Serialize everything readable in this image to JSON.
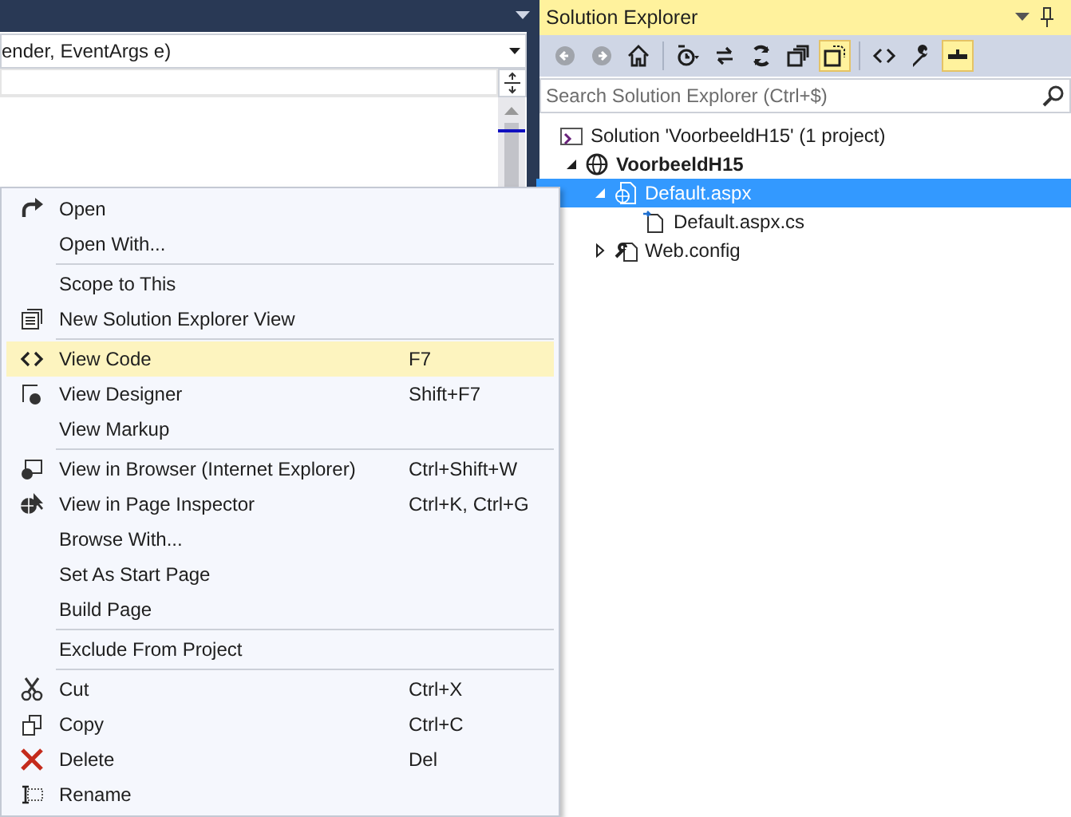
{
  "editor": {
    "member_dropdown": {
      "value": "ender, EventArgs e)"
    }
  },
  "solution_explorer": {
    "title": "Solution Explorer",
    "toolbar": [
      {
        "kind": "back",
        "disabled": true,
        "on": false
      },
      {
        "kind": "forward",
        "disabled": true,
        "on": false
      },
      {
        "kind": "home",
        "disabled": false,
        "on": false
      },
      {
        "kind": "history",
        "disabled": false,
        "on": false
      },
      {
        "kind": "sync",
        "disabled": false,
        "on": false
      },
      {
        "kind": "refresh",
        "disabled": false,
        "on": false
      },
      {
        "kind": "collapse",
        "disabled": false,
        "on": false
      },
      {
        "kind": "show-all",
        "disabled": false,
        "on": true
      },
      {
        "kind": "view-code",
        "disabled": false,
        "on": false
      },
      {
        "kind": "properties",
        "disabled": false,
        "on": false
      },
      {
        "kind": "preview",
        "disabled": false,
        "on": true
      }
    ],
    "search": {
      "placeholder": "Search Solution Explorer (Ctrl+$)"
    },
    "tree": [
      {
        "label": "Solution 'VoorbeeldH15' (1 project)",
        "kind": "solution",
        "selected": false,
        "children": [
          {
            "label": "VoorbeeldH15",
            "kind": "web-project",
            "bold": true,
            "expanded": true,
            "selected": false,
            "children": [
              {
                "label": "Default.aspx",
                "kind": "aspx",
                "expanded": true,
                "selected": true,
                "children": [
                  {
                    "label": "Default.aspx.cs",
                    "kind": "cs",
                    "selected": false
                  }
                ]
              },
              {
                "label": "Web.config",
                "kind": "config",
                "expanded": false,
                "selected": false
              }
            ]
          }
        ]
      }
    ]
  },
  "context_menu": {
    "groups": [
      [
        {
          "label": "Open",
          "kind": "open",
          "selected": false
        },
        {
          "label": "Open With...",
          "kind": "plain",
          "selected": false
        }
      ],
      [
        {
          "label": "Scope to This",
          "kind": "plain",
          "selected": false
        },
        {
          "label": "New Solution Explorer View",
          "kind": "new-view",
          "selected": false
        }
      ],
      [
        {
          "label": "View Code",
          "shortcut": "F7",
          "kind": "code",
          "selected": true
        },
        {
          "label": "View Designer",
          "shortcut": "Shift+F7",
          "kind": "designer",
          "selected": false
        },
        {
          "label": "View Markup",
          "kind": "plain",
          "selected": false
        }
      ],
      [
        {
          "label": "View in Browser (Internet Explorer)",
          "shortcut": "Ctrl+Shift+W",
          "kind": "browser",
          "selected": false
        },
        {
          "label": "View in Page Inspector",
          "shortcut": "Ctrl+K, Ctrl+G",
          "kind": "inspector",
          "selected": false
        },
        {
          "label": "Browse With...",
          "kind": "plain",
          "selected": false
        },
        {
          "label": "Set As Start Page",
          "kind": "plain",
          "selected": false
        },
        {
          "label": "Build Page",
          "kind": "plain",
          "selected": false
        }
      ],
      [
        {
          "label": "Exclude From Project",
          "kind": "plain",
          "selected": false
        }
      ],
      [
        {
          "label": "Cut",
          "shortcut": "Ctrl+X",
          "kind": "cut",
          "selected": false
        },
        {
          "label": "Copy",
          "shortcut": "Ctrl+C",
          "kind": "copy",
          "selected": false
        },
        {
          "label": "Delete",
          "shortcut": "Del",
          "kind": "delete",
          "selected": false
        },
        {
          "label": "Rename",
          "kind": "rename",
          "selected": false
        }
      ]
    ]
  }
}
